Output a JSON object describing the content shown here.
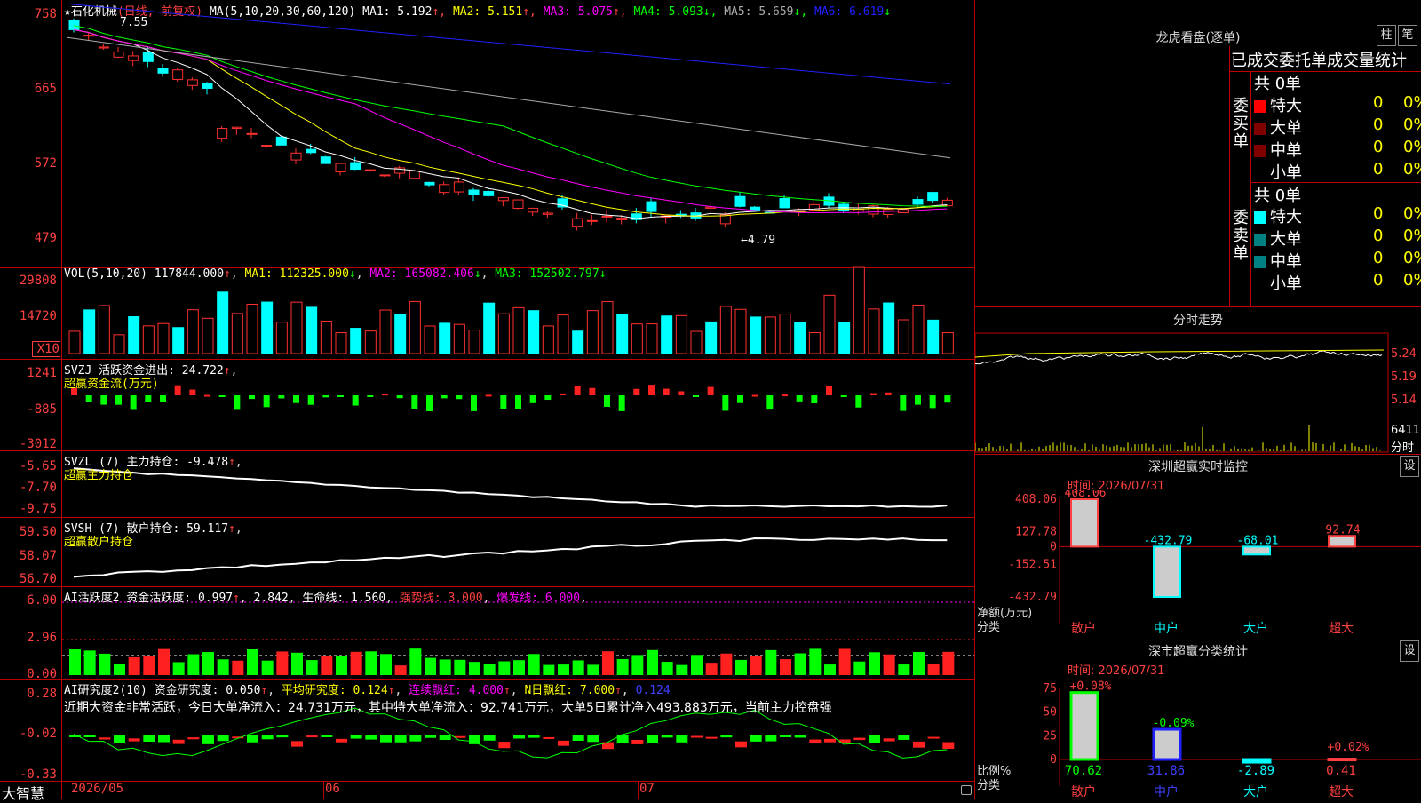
{
  "stock": {
    "title_prefix": "★石化机械",
    "period": "(日线, 前复权)",
    "ma_label": "MA(5,10,20,30,60,120)",
    "ma": [
      {
        "name": "MA1",
        "value": "5.192",
        "arrow": "↑",
        "color": "#ffffff"
      },
      {
        "name": "MA2",
        "value": "5.151",
        "arrow": "↑",
        "color": "#ffff00"
      },
      {
        "name": "MA3",
        "value": "5.075",
        "arrow": "↑",
        "color": "#ff00ff"
      },
      {
        "name": "MA4",
        "value": "5.093",
        "arrow": "↓",
        "color": "#00ff00"
      },
      {
        "name": "MA5",
        "value": "5.659",
        "arrow": "↓",
        "color": "#aaaaaa"
      },
      {
        "name": "MA6",
        "value": "6.619",
        "arrow": "↓",
        "color": "#2020ff"
      }
    ],
    "high_mark": "7.55",
    "low_mark": "←4.79"
  },
  "axes": {
    "price": [
      "758",
      "665",
      "572",
      "479"
    ],
    "vol": [
      "29808",
      "14720",
      "X10"
    ],
    "svzj": [
      "1241",
      "-885",
      "-3012"
    ],
    "svzl": [
      "-5.65",
      "-7.70",
      "-9.75"
    ],
    "svsh": [
      "59.50",
      "58.07",
      "56.70"
    ],
    "ai1": [
      "6.00",
      "2.96",
      "0.00"
    ],
    "ai2": [
      "0.28",
      "-0.02",
      "-0.33"
    ]
  },
  "vol_header": {
    "label": "VOL(5,10,20)",
    "value": "117844.000",
    "ma1": "MA1: 112325.000",
    "ma2": "MA2: 165082.406",
    "ma3": "MA3: 152502.797"
  },
  "svzj_header": {
    "label": "SVZJ  活跃资金进出: 24.722",
    "sub": "超赢资金流(万元)"
  },
  "svzl_header": {
    "label": "SVZL (7) 主力持仓: -9.478",
    "sub": "超赢主力持仓"
  },
  "svsh_header": {
    "label": "SVSH (7) 散户持仓: 59.117",
    "sub": "超赢散户持仓"
  },
  "ai1_header": {
    "label": "AI活跃度2 资金活跃度: 0.997",
    "v2": "2.842",
    "v3": "生命线: 1.560",
    "v4": "强势线: 3.000",
    "v5": "爆发线: 6.000"
  },
  "ai2_header": {
    "label": "AI研究度2(10) 资金研究度: 0.050",
    "v2": "平均研究度: 0.124",
    "v3": "连续飘红: 4.000",
    "v4": "N日飘红: 7.000",
    "v5": "0.124"
  },
  "ai2_note": "近期大资金非常活跃，今日大单净流入：24.731万元，其中特大单净流入：92.741万元，大单5日累计净入493.883万元，当前主力控盘强",
  "xaxis": [
    "2026/05",
    "06",
    "07"
  ],
  "brand": "大智慧",
  "right": {
    "lhb_title": "龙虎看盘(逐单)",
    "btn1": "柱",
    "btn2": "笔",
    "order_title": "已成交委托单成交量统计",
    "buy_label": "委买单",
    "sell_label": "委卖单",
    "buy_total": "共 0单",
    "sell_total": "共 0单",
    "buy_rows": [
      {
        "name": "特大",
        "count": "0",
        "pct": "0%",
        "color": "#ff0000"
      },
      {
        "name": "大单",
        "count": "0",
        "pct": "0%",
        "color": "#800000"
      },
      {
        "name": "中单",
        "count": "0",
        "pct": "0%",
        "color": "#800000"
      },
      {
        "name": "小单",
        "count": "0",
        "pct": "0%",
        "color": "#000000"
      }
    ],
    "sell_rows": [
      {
        "name": "特大",
        "count": "0",
        "pct": "0%",
        "color": "#00ffff"
      },
      {
        "name": "大单",
        "count": "0",
        "pct": "0%",
        "color": "#008080"
      },
      {
        "name": "中单",
        "count": "0",
        "pct": "0%",
        "color": "#008080"
      },
      {
        "name": "小单",
        "count": "0",
        "pct": "0%",
        "color": "#000000"
      }
    ],
    "intraday_title": "分时走势",
    "intraday_axis": [
      "5.24",
      "5.19",
      "5.14"
    ],
    "intraday_vol": "6411",
    "intraday_vol_unit": "分时",
    "monitor_title": "深圳超赢实时监控",
    "settings": "设",
    "monitor_time": "时间: 2026/07/31",
    "monitor_axis": [
      "408.06",
      "127.78",
      "0",
      "-152.51",
      "-432.79"
    ],
    "monitor_ylabel": "净额(万元)",
    "monitor_xlabel": "分类",
    "classify_title": "深市超赢分类统计",
    "classify_time": "时间: 2026/07/31",
    "classify_axis": [
      "75",
      "50",
      "25",
      "0"
    ],
    "classify_ylabel": "比例%",
    "classify_xlabel": "分类"
  },
  "chart_data": [
    {
      "type": "bar",
      "title": "深圳超赢实时监控",
      "ylabel": "净额(万元)",
      "categories": [
        "散户",
        "中户",
        "大户",
        "超大"
      ],
      "values": [
        408.06,
        -432.79,
        -68.01,
        92.74
      ],
      "ylim": [
        -432.79,
        408.06
      ]
    },
    {
      "type": "bar",
      "title": "深市超赢分类统计",
      "ylabel": "比例%",
      "categories": [
        "散户",
        "中户",
        "大户",
        "超大"
      ],
      "values": [
        70.62,
        31.86,
        -2.89,
        0.41
      ],
      "changes": [
        "+0.08%",
        "-0.09%",
        "",
        "+0.02%"
      ],
      "ylim": [
        0,
        75
      ]
    }
  ]
}
